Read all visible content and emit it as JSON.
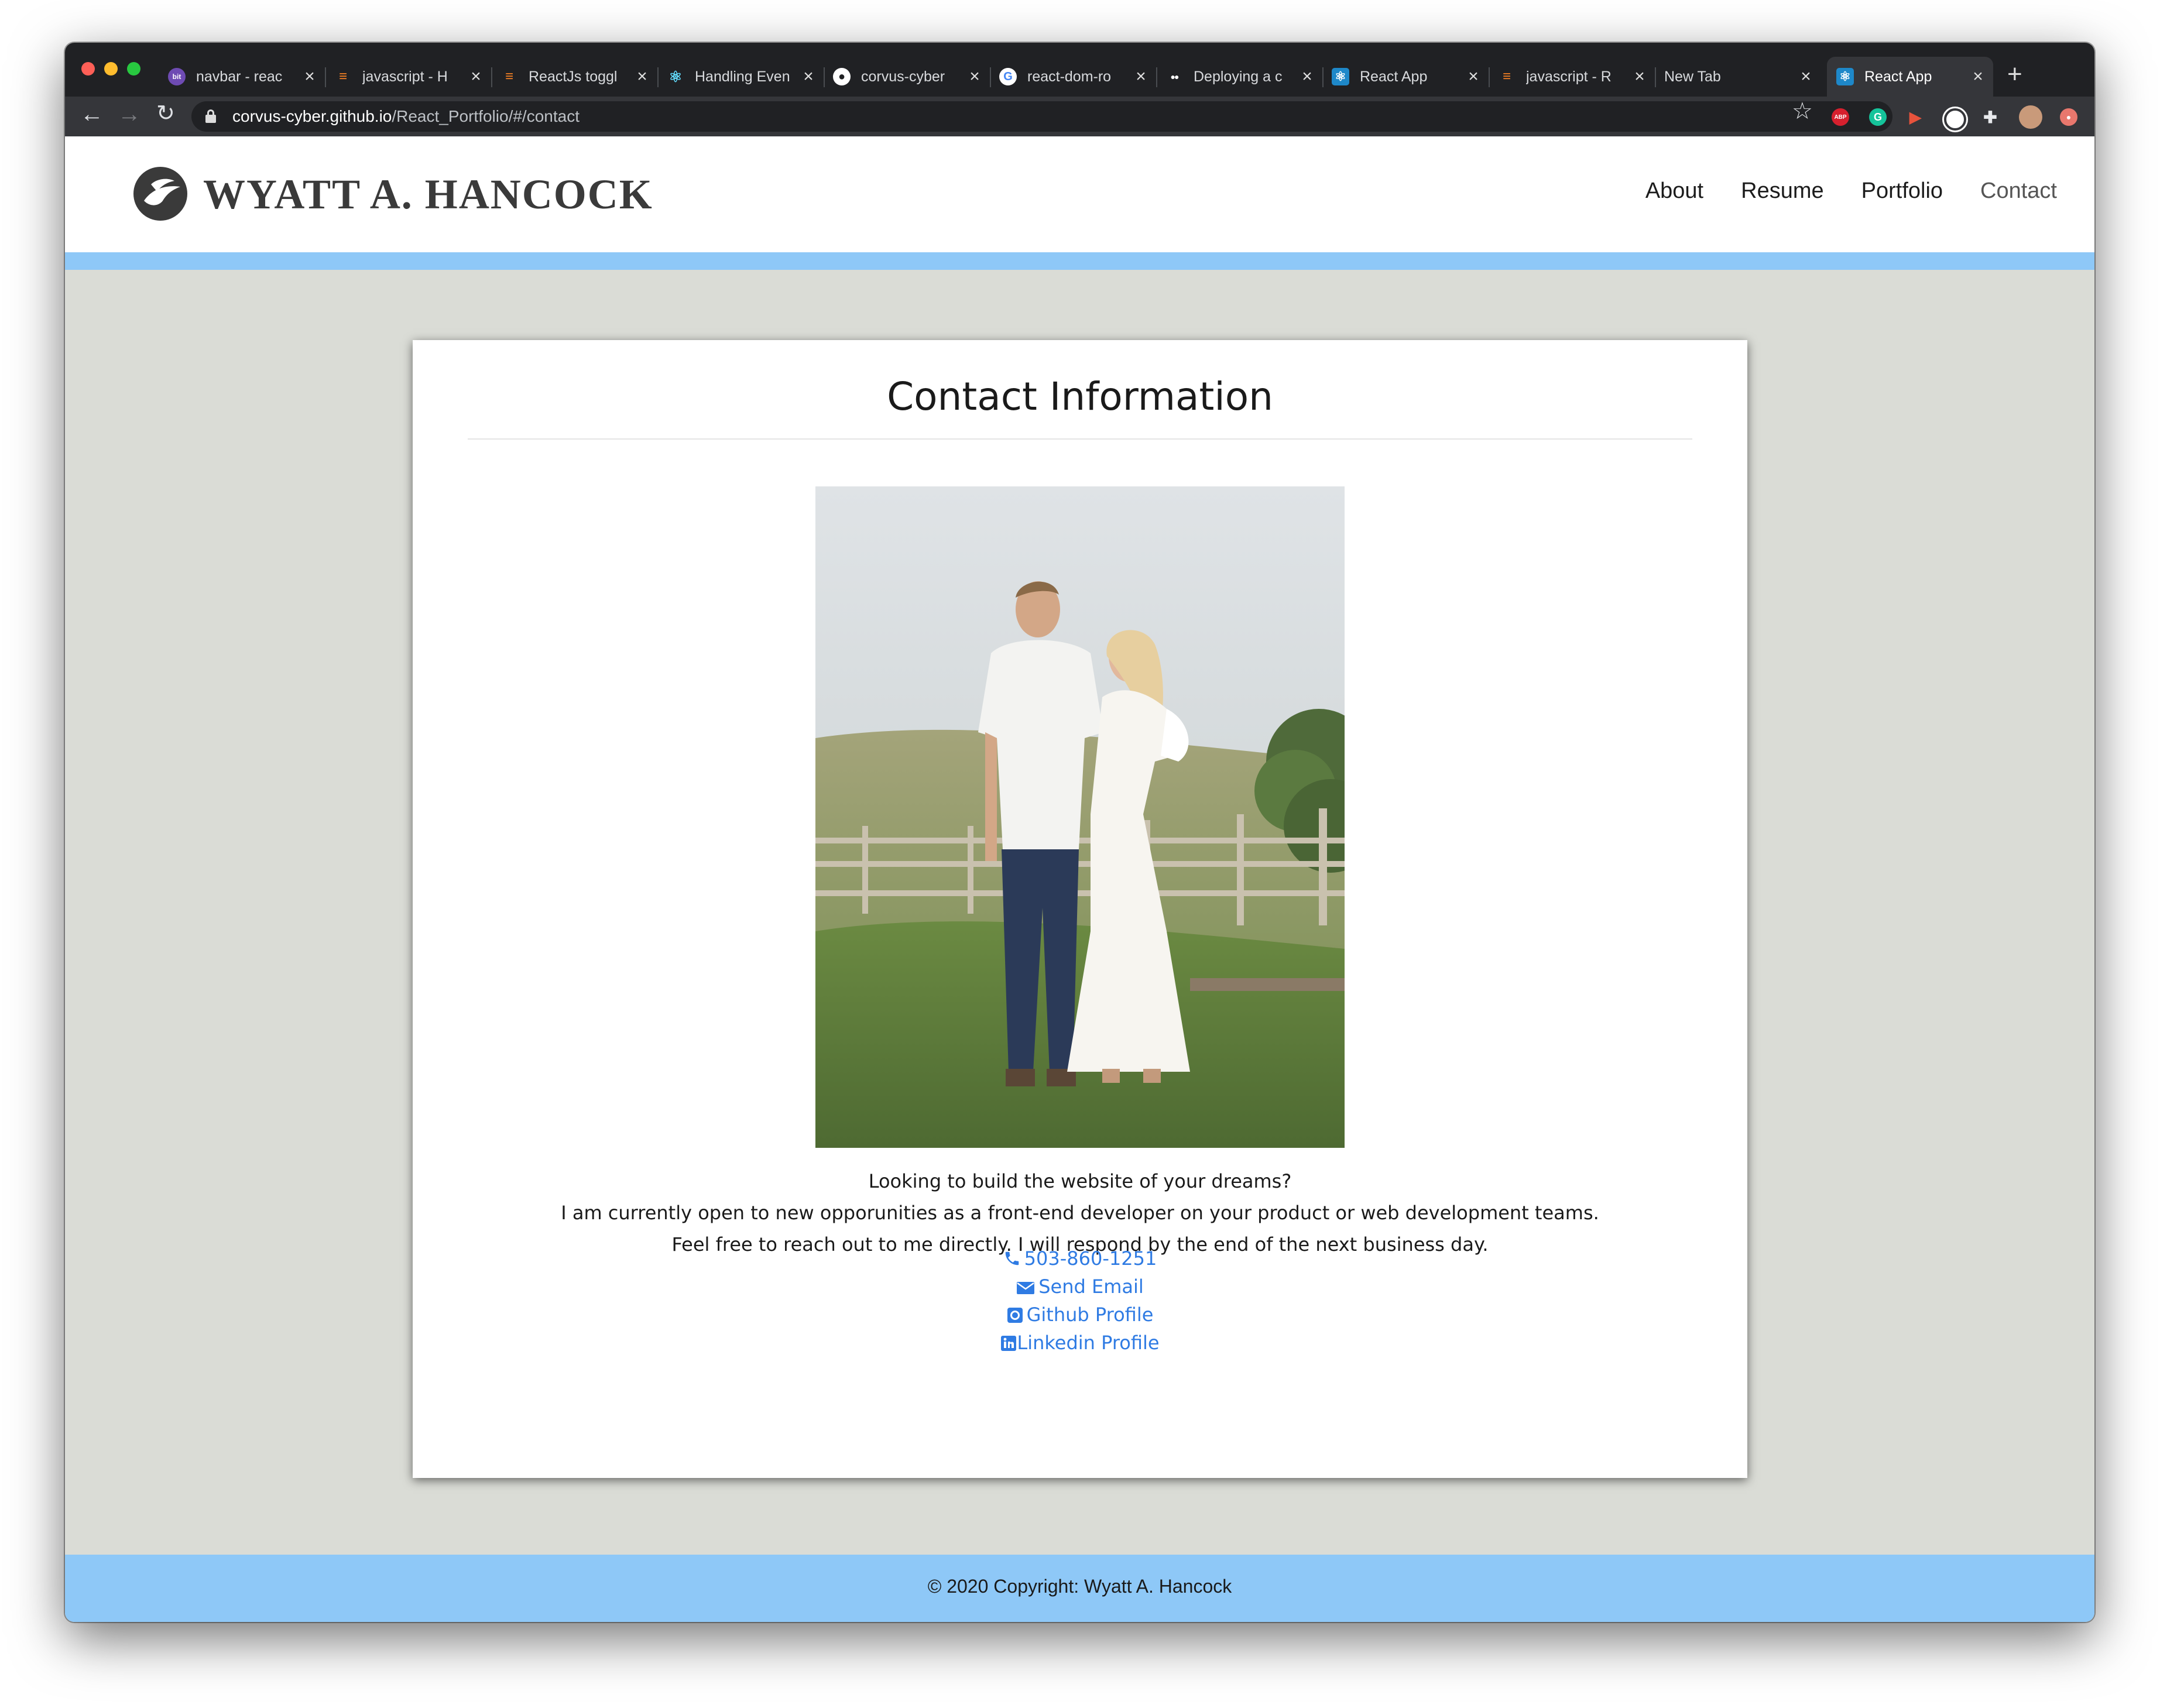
{
  "browser": {
    "tabs": [
      {
        "title": "navbar - reac",
        "favicon": "bit-icon",
        "color": "#6e4bb3",
        "glyph": "bit"
      },
      {
        "title": "javascript - H",
        "favicon": "stackoverflow-icon",
        "color": "#f48024",
        "glyph": "≡"
      },
      {
        "title": "ReactJs toggl",
        "favicon": "stackoverflow-icon",
        "color": "#f48024",
        "glyph": "≡"
      },
      {
        "title": "Handling Even",
        "favicon": "react-icon",
        "color": "#202124",
        "glyph": "⚛"
      },
      {
        "title": "corvus-cyber",
        "favicon": "github-icon",
        "color": "#ffffff",
        "glyph": "●"
      },
      {
        "title": "react-dom-ro",
        "favicon": "google-icon",
        "color": "#ffffff",
        "glyph": "G"
      },
      {
        "title": "Deploying a c",
        "favicon": "medium-icon",
        "color": "#ffffff",
        "glyph": "●●"
      },
      {
        "title": "React App",
        "favicon": "react-icon",
        "color": "#1e88c9",
        "glyph": "⚛"
      },
      {
        "title": "javascript - R",
        "favicon": "stackoverflow-icon",
        "color": "#f48024",
        "glyph": "≡"
      },
      {
        "title": "New Tab",
        "favicon": "",
        "color": "",
        "glyph": ""
      },
      {
        "title": "React App",
        "favicon": "react-icon",
        "color": "#1e88c9",
        "glyph": "⚛",
        "active": true
      }
    ],
    "url_host": "corvus-cyber.github.io",
    "url_path": "/React_Portfolio/#/contact",
    "extensions": [
      {
        "name": "adblock-plus-icon",
        "color": "#d6202e",
        "glyph": "ABP"
      },
      {
        "name": "grammarly-icon",
        "color": "#15c39a",
        "glyph": "G"
      },
      {
        "name": "screencast-icon",
        "color": "#e7533c",
        "glyph": "▶"
      },
      {
        "name": "extension-circle-icon",
        "color": "#ffffff",
        "glyph": ""
      },
      {
        "name": "puzzle-icon",
        "color": "#35363a",
        "glyph": "✚"
      },
      {
        "name": "profile-avatar-icon",
        "color": "#c99a7a",
        "glyph": ""
      },
      {
        "name": "update-icon",
        "color": "#e8776d",
        "glyph": "●"
      }
    ]
  },
  "site": {
    "brand": "WYATT A. HANCOCK",
    "nav": [
      "About",
      "Resume",
      "Portfolio",
      "Contact"
    ]
  },
  "contact": {
    "heading": "Contact Information",
    "message": [
      "Looking to build the website of your dreams?",
      "I am currently open to new opporunities as a front-end developer on your product or web development teams.",
      "Feel free to reach out to me directly. I will respond by the end of the next business day."
    ],
    "links": {
      "phone": "503-860-1251",
      "email": "Send Email",
      "github": "Github Profile",
      "linkedin": "Linkedin Profile"
    },
    "link_color": "#2f7be3"
  },
  "footer": {
    "text": "© 2020 Copyright: Wyatt A. Hancock"
  },
  "colors": {
    "accent_bar": "#8ec8f7",
    "page_bg": "#dadcd6"
  }
}
